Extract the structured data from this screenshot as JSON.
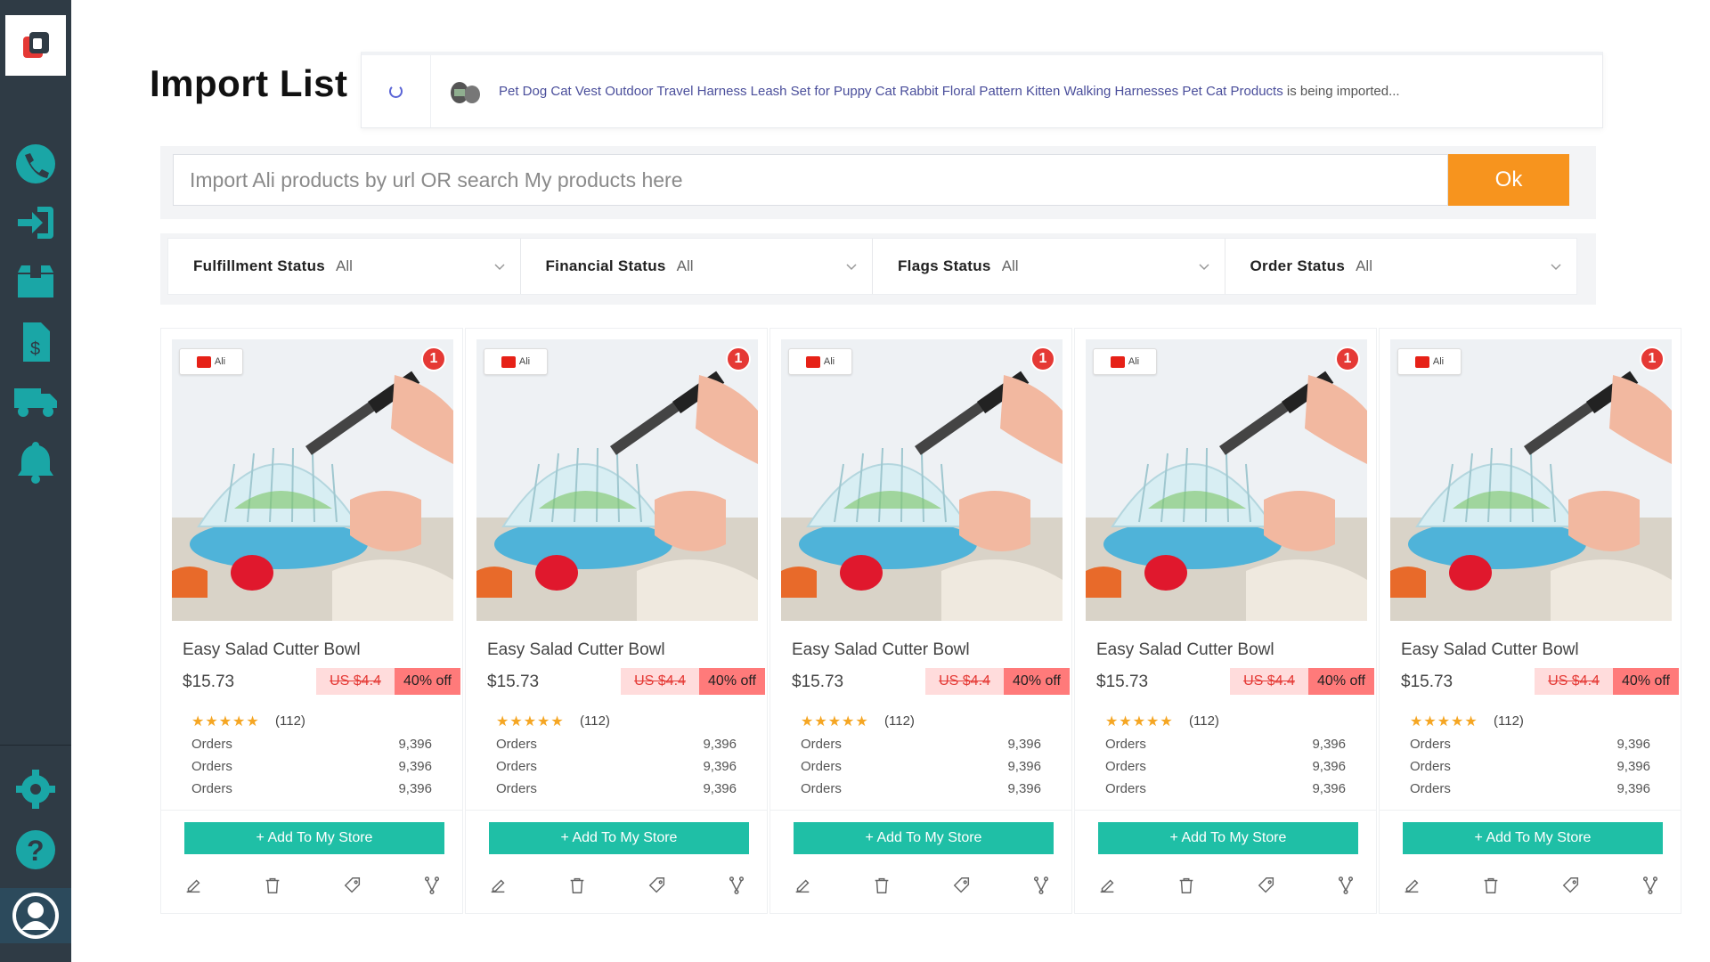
{
  "sidebar": {
    "logo_icon": "app-logo-icon",
    "accent": "#1aa6a6",
    "items": [
      {
        "icon": "phone-icon"
      },
      {
        "icon": "import-icon"
      },
      {
        "icon": "box-icon"
      },
      {
        "icon": "invoice-icon"
      },
      {
        "icon": "truck-icon"
      },
      {
        "icon": "bell-icon"
      },
      {
        "icon": "gear-icon"
      },
      {
        "icon": "help-icon"
      }
    ],
    "avatar_icon": "user-avatar-icon"
  },
  "header": {
    "title": "Import List"
  },
  "import_status": {
    "product_name": "Pet Dog Cat Vest Outdoor Travel Harness Leash Set for Puppy Cat Rabbit Floral Pattern Kitten Walking Harnesses Pet Cat Products",
    "status_text": " is being imported..."
  },
  "search": {
    "placeholder": "Import Ali products by url OR search My products here",
    "value": "",
    "ok_label": "Ok"
  },
  "filters": [
    {
      "label": "Fulfillment Status",
      "value": "All"
    },
    {
      "label": "Financial Status",
      "value": "All"
    },
    {
      "label": "Flags Status",
      "value": "All"
    },
    {
      "label": "Order Status",
      "value": "All"
    }
  ],
  "products": [
    {
      "source": "Ali",
      "badge_count": "1",
      "title": "Easy Salad Cutter Bowl",
      "price": "$15.73",
      "old_price": "US $4.4",
      "discount": "40% off",
      "rating": 5,
      "reviews": "(112)",
      "stats": [
        {
          "label": "Orders",
          "value": "9,396"
        },
        {
          "label": "Orders",
          "value": "9,396"
        },
        {
          "label": "Orders",
          "value": "9,396"
        }
      ],
      "add_label": "+ Add To My Store"
    },
    {
      "source": "Ali",
      "badge_count": "1",
      "title": "Easy Salad Cutter Bowl",
      "price": "$15.73",
      "old_price": "US $4.4",
      "discount": "40% off",
      "rating": 5,
      "reviews": "(112)",
      "stats": [
        {
          "label": "Orders",
          "value": "9,396"
        },
        {
          "label": "Orders",
          "value": "9,396"
        },
        {
          "label": "Orders",
          "value": "9,396"
        }
      ],
      "add_label": "+ Add To My Store"
    },
    {
      "source": "Ali",
      "badge_count": "1",
      "title": "Easy Salad Cutter Bowl",
      "price": "$15.73",
      "old_price": "US $4.4",
      "discount": "40% off",
      "rating": 5,
      "reviews": "(112)",
      "stats": [
        {
          "label": "Orders",
          "value": "9,396"
        },
        {
          "label": "Orders",
          "value": "9,396"
        },
        {
          "label": "Orders",
          "value": "9,396"
        }
      ],
      "add_label": "+ Add To My Store"
    },
    {
      "source": "Ali",
      "badge_count": "1",
      "title": "Easy Salad Cutter Bowl",
      "price": "$15.73",
      "old_price": "US $4.4",
      "discount": "40% off",
      "rating": 5,
      "reviews": "(112)",
      "stats": [
        {
          "label": "Orders",
          "value": "9,396"
        },
        {
          "label": "Orders",
          "value": "9,396"
        },
        {
          "label": "Orders",
          "value": "9,396"
        }
      ],
      "add_label": "+ Add To My Store"
    },
    {
      "source": "Ali",
      "badge_count": "1",
      "title": "Easy Salad Cutter Bowl",
      "price": "$15.73",
      "old_price": "US $4.4",
      "discount": "40% off",
      "rating": 5,
      "reviews": "(112)",
      "stats": [
        {
          "label": "Orders",
          "value": "9,396"
        },
        {
          "label": "Orders",
          "value": "9,396"
        },
        {
          "label": "Orders",
          "value": "9,396"
        }
      ],
      "add_label": "+ Add To My Store"
    }
  ],
  "colors": {
    "sidebar_bg": "#2f3b45",
    "ok_button": "#f7941e",
    "add_button": "#1fbfa6",
    "discount_bg": "#ff7a7a",
    "old_price_bg": "#ffdcdc",
    "badge_red": "#e53935",
    "star": "#f5a623"
  }
}
